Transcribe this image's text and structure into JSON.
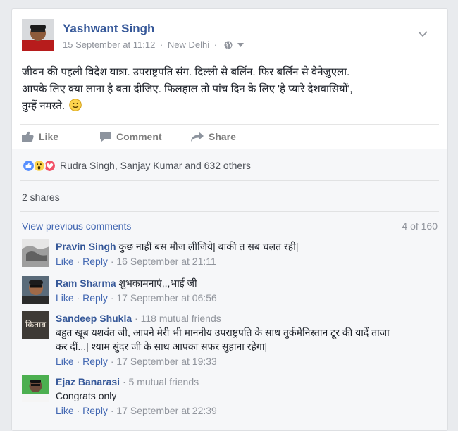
{
  "post": {
    "author": "Yashwant Singh",
    "date": "15 September at 11:12",
    "location": "New Delhi",
    "text_line1": "जीवन की पहली विदेश यात्रा. उपराष्ट्रपति संग. दिल्ली से बर्लिन. फिर बर्लिन से वेनेजुएला.",
    "text_line2": "आपके लिए क्या लाना है बता दीजिए. फिलहाल तो पांच दिन के लिए 'हे प्यारे देशवासियों',",
    "text_line3": "तुम्हें नमस्ते."
  },
  "actions": {
    "like": "Like",
    "comment": "Comment",
    "share": "Share"
  },
  "feedback": {
    "reaction_names": "Rudra Singh, Sanjay Kumar and 632 others",
    "shares": "2 shares",
    "view_previous": "View previous comments",
    "count": "4 of 160"
  },
  "comments": [
    {
      "name": "Pravin Singh",
      "mutual": "",
      "text": "कुछ नाहीं बस मौज लीजिये| बाकी त सब चलत रही|",
      "like": "Like",
      "reply": "Reply",
      "time": "16 September at 21:11"
    },
    {
      "name": "Ram Sharma",
      "mutual": "",
      "text": "शुभकामनाएं,,,भाई जी",
      "like": "Like",
      "reply": "Reply",
      "time": "17 September at 06:56"
    },
    {
      "name": "Sandeep Shukla",
      "mutual": "118 mutual friends",
      "text_line1": "बहुत खूब यशवंत जी, आपने मेरी भी माननीय उपराष्ट्रपति के साथ तुर्कमेनिस्तान टूर की यादें ताजा",
      "text_line2": "कर दीं...| श्याम सुंदर जी के साथ आपका सफर सुहाना रहेगा|",
      "avatar_text": "किताब",
      "like": "Like",
      "reply": "Reply",
      "time": "17 September at 19:33"
    },
    {
      "name": "Ejaz Banarasi",
      "mutual": "5 mutual friends",
      "text": "Congrats only",
      "like": "Like",
      "reply": "Reply",
      "time": "17 September at 22:39"
    }
  ],
  "meta_sep": "·",
  "colors": {
    "link": "#365899",
    "accent": "#4267b2",
    "muted": "#90949c",
    "bg": "#e9ebee"
  },
  "icons": [
    "globe-icon",
    "caret-down-icon",
    "chevron-down-icon",
    "like-icon",
    "comment-icon",
    "share-icon",
    "like-reaction-icon",
    "wow-reaction-icon",
    "love-reaction-icon",
    "smiley-icon"
  ]
}
